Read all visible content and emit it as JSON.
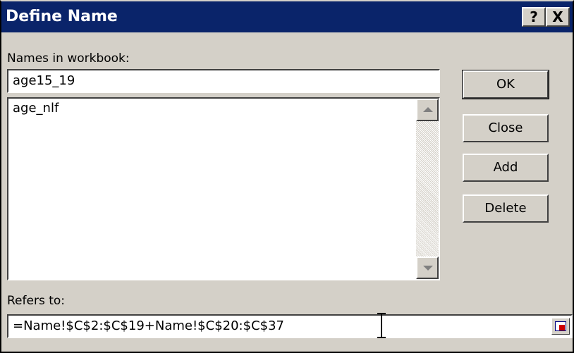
{
  "window": {
    "title": "Define Name",
    "help_button": "?",
    "close_button": "X"
  },
  "names_label": "Names in workbook:",
  "name_input": {
    "value": "age15_19"
  },
  "names_list": {
    "items": [
      "age_nlf"
    ]
  },
  "buttons": {
    "ok": "OK",
    "close": "Close",
    "add": "Add",
    "delete": "Delete"
  },
  "refers_label": "Refers to:",
  "refers_input": {
    "value": "=Name!$C$2:$C$19+Name!$C$20:$C$37"
  },
  "icons": {
    "collapse_dialog": "collapse-dialog-icon",
    "cursor": "text-cursor-icon"
  },
  "colors": {
    "titlebar": "#0a246a",
    "dialog_bg": "#d4d0c8"
  }
}
